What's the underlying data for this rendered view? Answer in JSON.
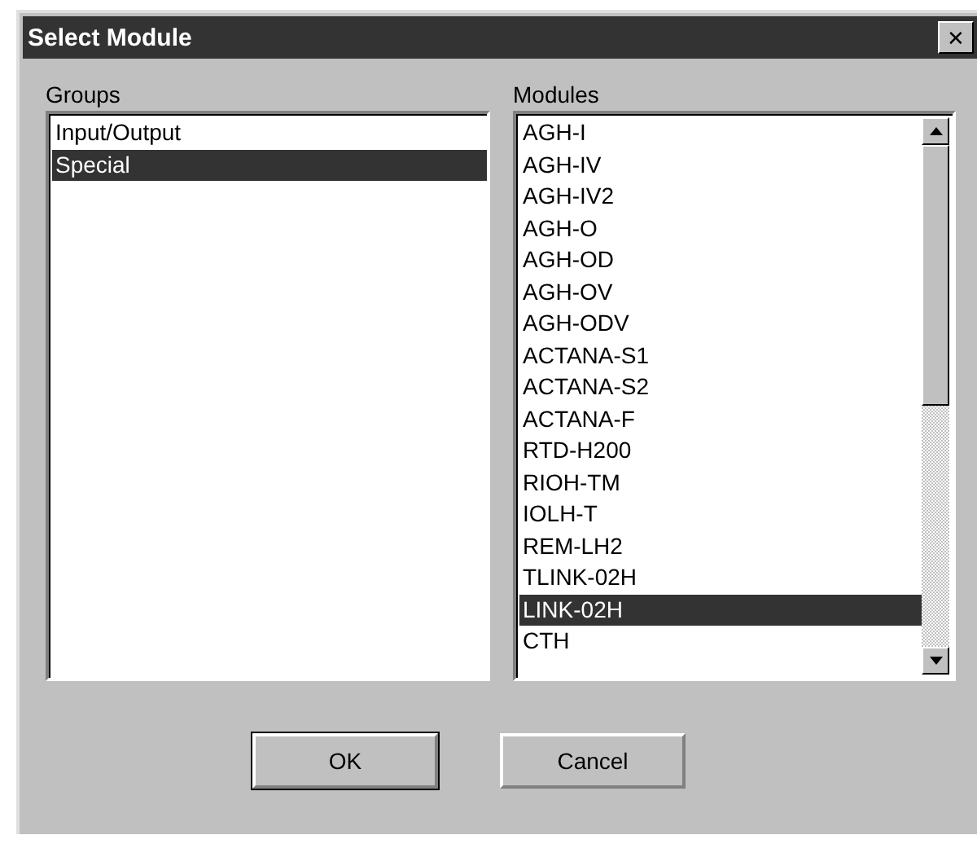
{
  "window": {
    "title": "Select Module",
    "close": "✕"
  },
  "groups": {
    "label": "Groups",
    "items": [
      {
        "label": "Input/Output",
        "selected": false
      },
      {
        "label": "Special",
        "selected": true
      }
    ]
  },
  "modules": {
    "label": "Modules",
    "items": [
      {
        "label": "AGH-I",
        "selected": false
      },
      {
        "label": "AGH-IV",
        "selected": false
      },
      {
        "label": "AGH-IV2",
        "selected": false
      },
      {
        "label": "AGH-O",
        "selected": false
      },
      {
        "label": "AGH-OD",
        "selected": false
      },
      {
        "label": "AGH-OV",
        "selected": false
      },
      {
        "label": "AGH-ODV",
        "selected": false
      },
      {
        "label": "ACTANA-S1",
        "selected": false
      },
      {
        "label": "ACTANA-S2",
        "selected": false
      },
      {
        "label": "ACTANA-F",
        "selected": false
      },
      {
        "label": "RTD-H200",
        "selected": false
      },
      {
        "label": "RIOH-TM",
        "selected": false
      },
      {
        "label": "IOLH-T",
        "selected": false
      },
      {
        "label": "REM-LH2",
        "selected": false
      },
      {
        "label": "TLINK-02H",
        "selected": false
      },
      {
        "label": "LINK-02H",
        "selected": true
      },
      {
        "label": "CTH",
        "selected": false
      }
    ]
  },
  "buttons": [
    {
      "label": "OK",
      "default": true
    },
    {
      "label": "Cancel",
      "default": false
    }
  ]
}
